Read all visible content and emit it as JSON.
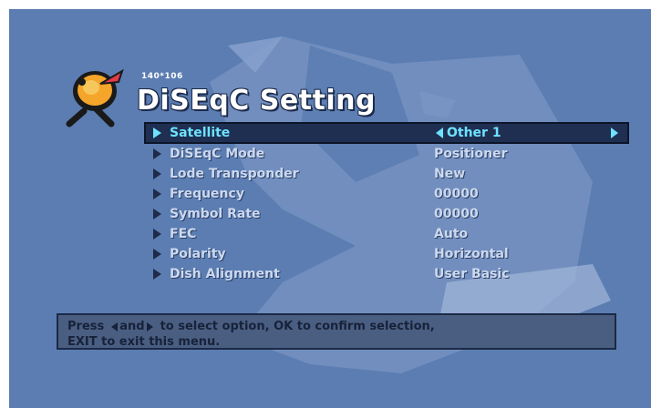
{
  "header": {
    "resolution_label": "140*106",
    "title": "DiSEqC Setting"
  },
  "menu": {
    "selected_index": 0,
    "items": [
      {
        "label": "Satellite",
        "value": "Other 1"
      },
      {
        "label": "DiSEqC Mode",
        "value": "Positioner"
      },
      {
        "label": "Lode Transponder",
        "value": "New"
      },
      {
        "label": "Frequency",
        "value": "00000"
      },
      {
        "label": "Symbol Rate",
        "value": "00000"
      },
      {
        "label": "FEC",
        "value": "Auto"
      },
      {
        "label": "Polarity",
        "value": "Horizontal"
      },
      {
        "label": "Dish Alignment",
        "value": "User Basic"
      }
    ]
  },
  "help": {
    "press": "Press",
    "and": "and",
    "line1_rest": "to select option, OK to confirm selection,",
    "line2": "EXIT to exit this menu."
  },
  "colors": {
    "background": "#5b7db2",
    "highlight_text": "#6de3ff",
    "highlight_bar": "#1f2f52"
  },
  "icons": {
    "logo": "satellite-dish-icon"
  }
}
